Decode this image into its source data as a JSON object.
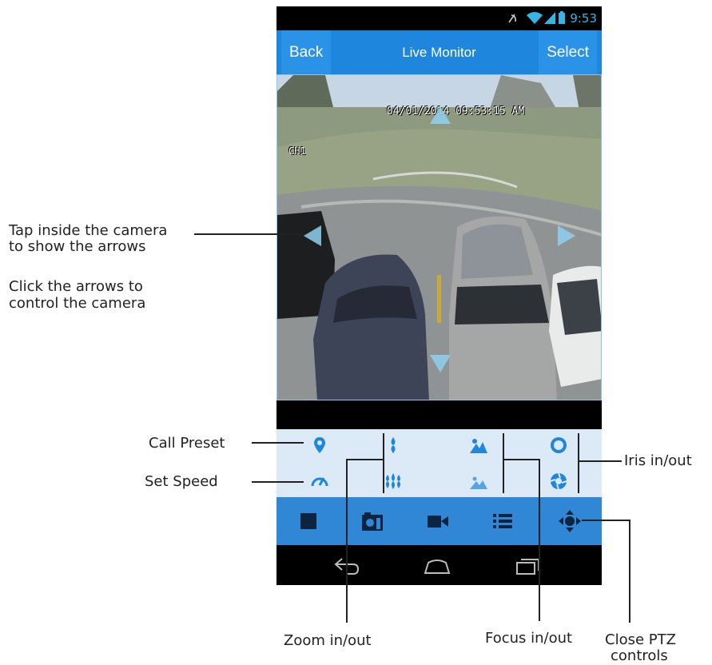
{
  "status_bar": {
    "time": "9:53"
  },
  "header": {
    "back_label": "Back",
    "title": "Live Monitor",
    "select_label": "Select"
  },
  "video": {
    "timestamp": "04/01/2014 09:53:15 AM",
    "channel": "CH1"
  },
  "colors": {
    "accent": "#1e86dc",
    "toolbar": "#2f87d6",
    "ptz_panel": "#dce9f7",
    "icon": "#1e86dc"
  },
  "ptz_controls": {
    "icons": [
      "call-preset-icon",
      "set-speed-icon",
      "zoom-in-icon",
      "zoom-out-icon",
      "focus-in-icon",
      "focus-out-icon",
      "iris-in-icon",
      "iris-out-icon"
    ]
  },
  "toolbar": {
    "icons": [
      "stop-icon",
      "snapshot-icon",
      "record-icon",
      "list-icon",
      "ptz-icon"
    ]
  },
  "nav": {
    "icons": [
      "back-nav-icon",
      "home-nav-icon",
      "recent-apps-icon"
    ]
  },
  "annotations": {
    "tap_line1": "Tap inside the camera",
    "tap_line2": "to show the arrows",
    "click_line1": "Click the arrows to",
    "click_line2": "control the camera",
    "call_preset": "Call Preset",
    "set_speed": "Set Speed",
    "iris": "Iris in/out",
    "zoom": "Zoom in/out",
    "focus": "Focus in/out",
    "close_line1": "Close PTZ",
    "close_line2": "controls"
  }
}
